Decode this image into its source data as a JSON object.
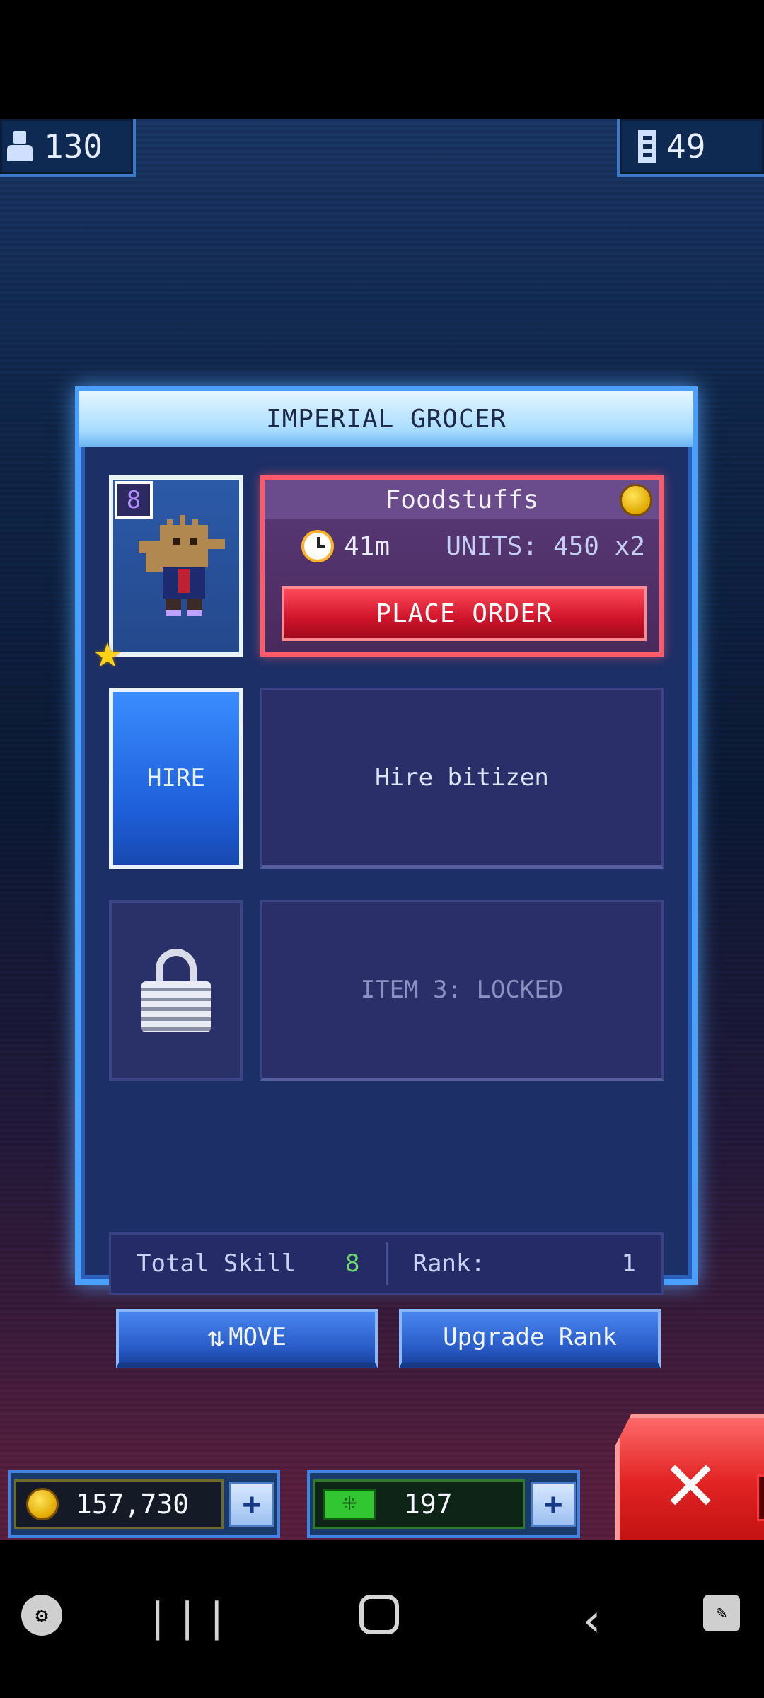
{
  "top_counters": {
    "population": "130",
    "floors": "49"
  },
  "panel": {
    "title": "IMPERIAL GROCER",
    "slot1": {
      "level": "8",
      "job_name": "Foodstuffs",
      "time": "41m",
      "units": "UNITS: 450 x2",
      "action": "PLACE ORDER"
    },
    "slot2": {
      "button": "HIRE",
      "text": "Hire bitizen"
    },
    "slot3": {
      "text": "ITEM 3: LOCKED"
    },
    "stats": {
      "skill_label": "Total Skill",
      "skill_value": "8",
      "rank_label": "Rank:",
      "rank_value": "1"
    },
    "buttons": {
      "move": "MOVE",
      "upgrade": "Upgrade Rank"
    }
  },
  "resources": {
    "coins": "157,730",
    "bux": "197"
  },
  "icons": {
    "population": "person-icon",
    "floors": "floors-icon",
    "coin": "coin-icon",
    "clock": "clock-icon",
    "star": "star-icon",
    "lock": "lock-icon",
    "bux": "bux-icon",
    "close": "close-icon"
  },
  "colors": {
    "panel_border": "#4aa0ff",
    "place_order": "#d0142a",
    "hire": "#1e5ed8",
    "close": "#e22424"
  }
}
